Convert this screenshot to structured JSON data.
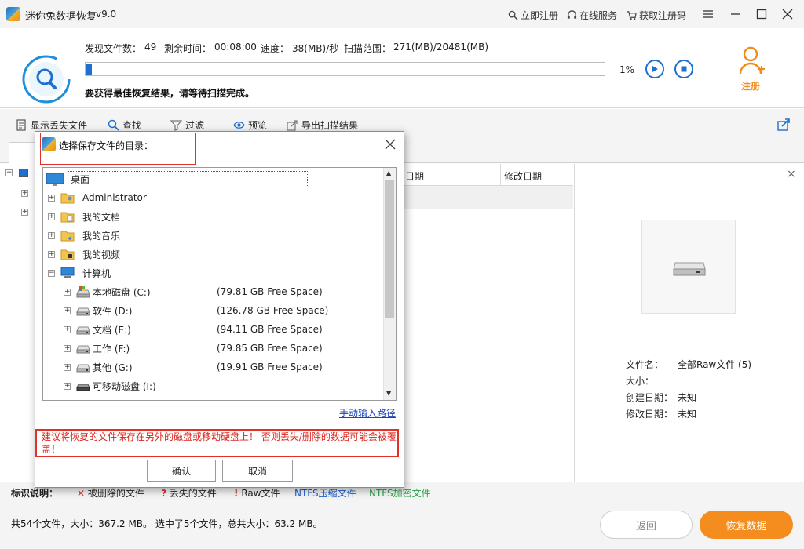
{
  "app": {
    "title": "迷你兔数据恢复",
    "version": "v9.0",
    "links": {
      "register_now": "立即注册",
      "online_service": "在线服务",
      "get_code": "获取注册码"
    }
  },
  "scan": {
    "found_label": "发现文件数：",
    "found_value": "49",
    "remain_label": "剩余时间：",
    "remain_value": "00:08:00",
    "speed_label": "速度：",
    "speed_value": "38(MB)/秒",
    "range_label": "扫描范围：",
    "range_value": "271(MB)/20481(MB)",
    "progress_percent": "1%",
    "progress_fraction": 0.01,
    "tip": "要获得最佳恢复结果，请等待扫描完成。",
    "register_label": "注册"
  },
  "toolbar": {
    "show_lost": "显示丢失文件",
    "find": "查找",
    "filter": "过滤",
    "preview": "预览",
    "export": "导出扫描结果"
  },
  "file_table": {
    "col_created": "日期",
    "col_modified": "修改日期"
  },
  "details": {
    "name_label": "文件名：",
    "name_value": "全部Raw文件 (5)",
    "size_label": "大小：",
    "created_label": "创建日期：",
    "created_value": "未知",
    "modified_label": "修改日期：",
    "modified_value": "未知"
  },
  "legend": {
    "title": "标识说明：",
    "deleted": "被删除的文件",
    "lost": "丢失的文件",
    "raw": "Raw文件",
    "ntfs_compressed": "NTFS压缩文件",
    "ntfs_encrypted": "NTFS加密文件"
  },
  "footer": {
    "summary": "共54个文件，大小：367.2 MB。 选中了5个文件，总共大小：63.2 MB。",
    "back": "返回",
    "recover": "恢复数据"
  },
  "dialog": {
    "title": "选择保存文件的目录：",
    "tree": {
      "desktop": "桌面",
      "administrator": "Administrator",
      "documents": "我的文档",
      "music": "我的音乐",
      "videos": "我的视频",
      "computer": "计算机",
      "drives": [
        {
          "label": "本地磁盘 (C:)",
          "free": "(79.81 GB Free Space)"
        },
        {
          "label": "软件 (D:)",
          "free": "(126.78 GB Free Space)"
        },
        {
          "label": "文档 (E:)",
          "free": "(94.11 GB Free Space)"
        },
        {
          "label": "工作 (F:)",
          "free": "(79.85 GB Free Space)"
        },
        {
          "label": "其他 (G:)",
          "free": "(19.91 GB Free Space)"
        },
        {
          "label": "可移动磁盘 (I:)",
          "free": ""
        }
      ]
    },
    "manual_path": "手动输入路径",
    "warning": "建议将恢复的文件保存在另外的磁盘或移动硬盘上！ 否则丢失/删除的数据可能会被覆盖！",
    "ok": "确认",
    "cancel": "取消"
  },
  "colors": {
    "accent": "#1e6fd0",
    "orange": "#f58c1e",
    "warning_red": "#e0302a"
  }
}
